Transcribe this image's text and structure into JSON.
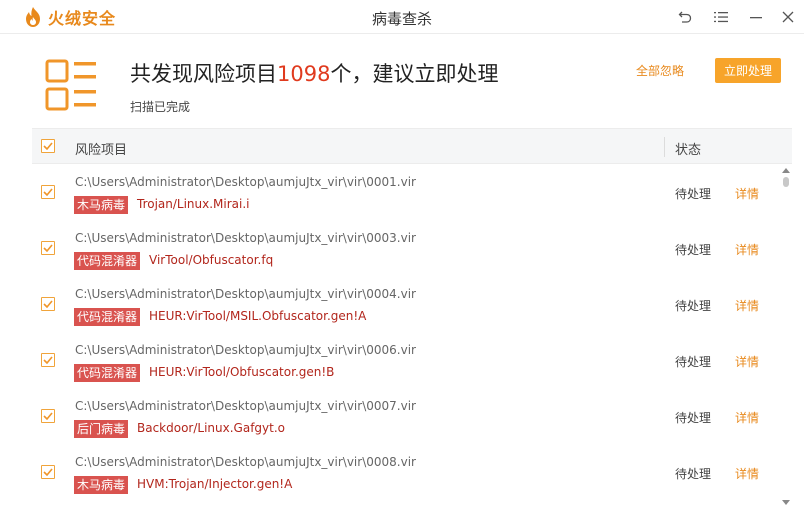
{
  "app": {
    "logo_text": "火绒安全",
    "title": "病毒查杀",
    "brand_color": "#e8891c"
  },
  "summary": {
    "prefix": "共发现风险项目",
    "count": "1098",
    "suffix": "个，建议立即处理",
    "sub": "扫描已完成",
    "ignore_all": "全部忽略",
    "handle_now": "立即处理"
  },
  "table": {
    "col_name": "风险项目",
    "col_status": "状态",
    "rows": [
      {
        "path": "C:\\Users\\Administrator\\Desktop\\aumjuJtx_vir\\vir\\0001.vir",
        "tag": "木马病毒",
        "virus": "Trojan/Linux.Mirai.i",
        "status": "待处理",
        "detail": "详情",
        "checked": true
      },
      {
        "path": "C:\\Users\\Administrator\\Desktop\\aumjuJtx_vir\\vir\\0003.vir",
        "tag": "代码混淆器",
        "virus": "VirTool/Obfuscator.fq",
        "status": "待处理",
        "detail": "详情",
        "checked": true
      },
      {
        "path": "C:\\Users\\Administrator\\Desktop\\aumjuJtx_vir\\vir\\0004.vir",
        "tag": "代码混淆器",
        "virus": "HEUR:VirTool/MSIL.Obfuscator.gen!A",
        "status": "待处理",
        "detail": "详情",
        "checked": true
      },
      {
        "path": "C:\\Users\\Administrator\\Desktop\\aumjuJtx_vir\\vir\\0006.vir",
        "tag": "代码混淆器",
        "virus": "HEUR:VirTool/Obfuscator.gen!B",
        "status": "待处理",
        "detail": "详情",
        "checked": true
      },
      {
        "path": "C:\\Users\\Administrator\\Desktop\\aumjuJtx_vir\\vir\\0007.vir",
        "tag": "后门病毒",
        "virus": "Backdoor/Linux.Gafgyt.o",
        "status": "待处理",
        "detail": "详情",
        "checked": true
      },
      {
        "path": "C:\\Users\\Administrator\\Desktop\\aumjuJtx_vir\\vir\\0008.vir",
        "tag": "木马病毒",
        "virus": "HVM:Trojan/Injector.gen!A",
        "status": "待处理",
        "detail": "详情",
        "checked": true
      }
    ]
  },
  "icons": {
    "back": "back-icon",
    "menu": "menu-icon",
    "minimize": "minimize-icon",
    "close": "close-icon",
    "checkmark": "checkmark-icon",
    "list": "list-report-icon"
  },
  "colors": {
    "accent": "#f7a42a",
    "danger_tag": "#d9534f",
    "virus_text": "#b2261c",
    "count_text": "#e03a1e"
  }
}
